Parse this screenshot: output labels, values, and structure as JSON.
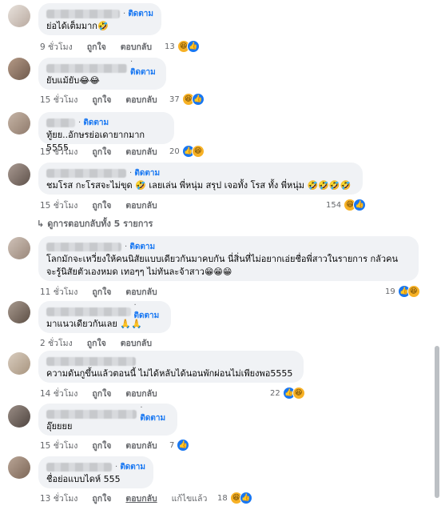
{
  "ui": {
    "follow_label": "ติดตาม",
    "like_label": "ถูกใจ",
    "reply_label": "ตอบกลับ",
    "edited_label": "แก้ไขแล้ว"
  },
  "view_replies": "ดูการตอบกลับทั้ง 5 รายการ",
  "comments": [
    {
      "text": "ย่อได้เต็มมาก🤣",
      "time": "9 ชั่วโมง",
      "count": "13"
    },
    {
      "text": "ยับแม้ยับ😂😂",
      "time": "15 ชั่วโมง",
      "count": "37"
    },
    {
      "text": "ทู้ยย..อักษรย่อเดายากมาก 5555",
      "time": "15 ชั่วโมง",
      "count": "20"
    },
    {
      "text": "ชมโรส กะโรสจะไม่ขุด 🤣 เลยเล่น พี่หนุ่ม สรุป เจอทั้ง โรส ทั้ง พี่หนุ่ม 🤣🤣🤣🤣",
      "time": "15 ชั่วโมง",
      "count": "154"
    },
    {
      "text": "โลกมักจะเหวี่ยงให้คนนิสัยแบบเดียวกันมาคบกัน นี่สิ่นที่ไม่อยากเอ่ยชื่อพี่สาวในรายการ กลัวคน\nจะรู้นิสัยตัวเองหมด เทอๆๆ ไม่ทันละจ้าสาว😁😁😁",
      "time": "11 ชั่วโมง",
      "count": "19"
    },
    {
      "text": "มาแนวเดียวกันเลย 🙏🙏",
      "time": "2 ชั่วโมง",
      "count": ""
    },
    {
      "text": "ความดันกูขึ้นแล้วตอนนี้ ไม่ได้หลับได้นอนพักผ่อนไม่เพียงพอ5555",
      "time": "14 ชั่วโมง",
      "count": "22"
    },
    {
      "text": "อุ๊ยยยย",
      "time": "15 ชั่วโมง",
      "count": "7"
    },
    {
      "text": "ชื่อย่อแบบไดห์ 555",
      "time": "13 ชั่วโมง",
      "count": "18"
    }
  ]
}
